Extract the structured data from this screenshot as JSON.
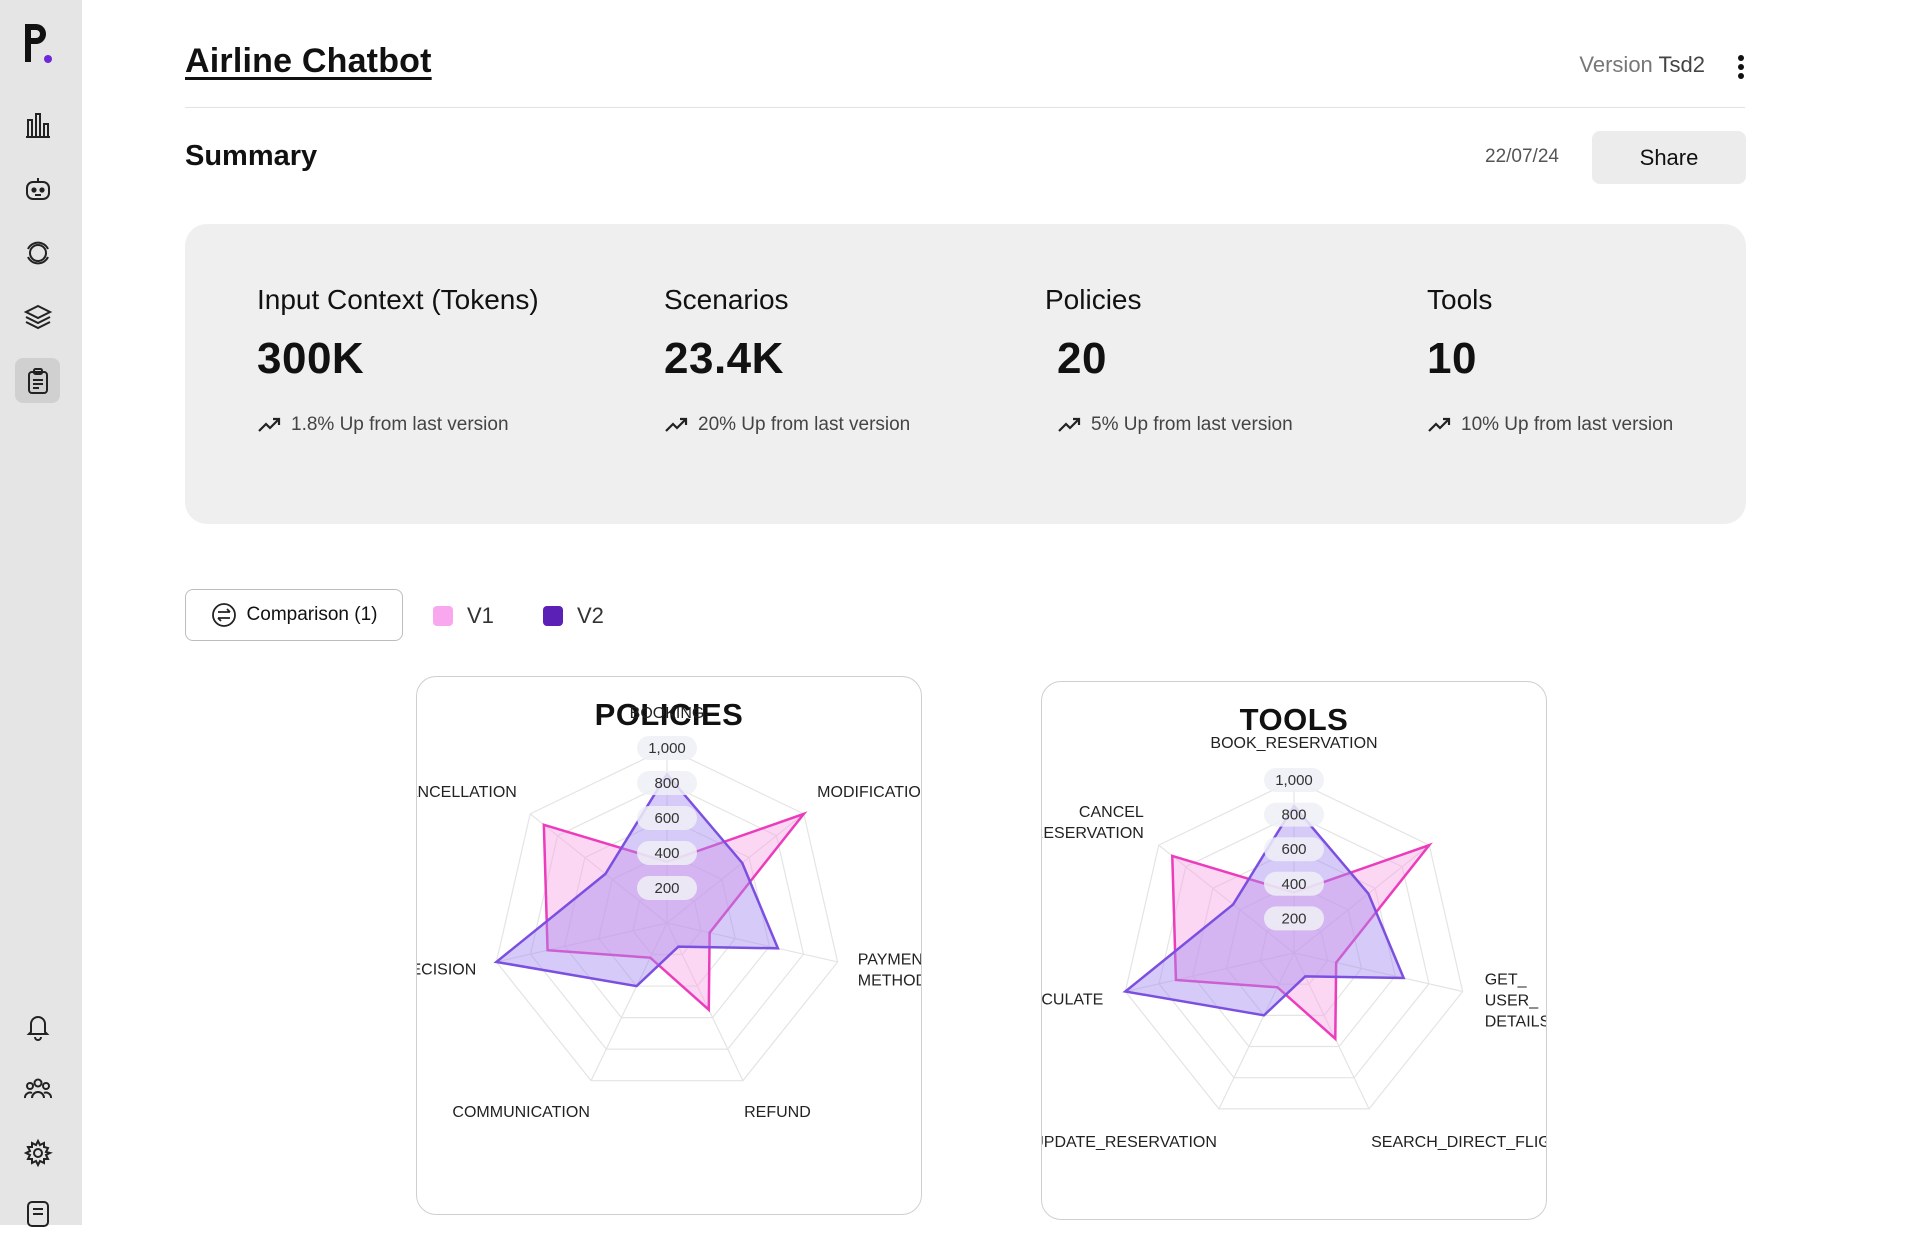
{
  "app": {
    "title": "Airline Chatbot",
    "version_label": "Version",
    "version_value": "Tsd2"
  },
  "sidebar": {
    "logo_letter": "P",
    "items": [
      {
        "icon": "bar-chart-icon"
      },
      {
        "icon": "bot-icon"
      },
      {
        "icon": "orbit-icon"
      },
      {
        "icon": "layers-icon"
      },
      {
        "icon": "clipboard-icon",
        "active": true
      },
      {
        "icon": "bell-icon"
      },
      {
        "icon": "team-icon"
      },
      {
        "icon": "gear-icon"
      },
      {
        "icon": "notes-icon"
      }
    ]
  },
  "summary": {
    "title": "Summary",
    "date": "22/07/24",
    "share_label": "Share"
  },
  "stats": [
    {
      "label": "Input Context (Tokens)",
      "value": "300K",
      "trend": "1.8% Up from last version"
    },
    {
      "label": "Scenarios",
      "value": "23.4K",
      "trend": "20% Up from last version"
    },
    {
      "label": "Policies",
      "value": "20",
      "trend": "5% Up from last version"
    },
    {
      "label": "Tools",
      "value": "10",
      "trend": "10% Up from last version"
    }
  ],
  "comparison": {
    "button_label": "Comparison (1)",
    "legend": [
      {
        "name": "V1",
        "color": "#f9a8f0"
      },
      {
        "name": "V2",
        "color": "#5b21b6"
      }
    ]
  },
  "colors": {
    "v1_stroke": "#ec3cbc",
    "v1_fill": "#f7a6e4",
    "v2_stroke": "#7b4fe0",
    "v2_fill": "#a38cf0"
  },
  "chart_data": [
    {
      "type": "radar",
      "title": "POLICIES",
      "axes": [
        "BOOKING",
        "MODIFICATION",
        "PAYMENT METHODS",
        "REFUND",
        "COMMUNICATION",
        "PRECISION",
        "CANCELLATION"
      ],
      "ticks": [
        "200",
        "400",
        "600",
        "800",
        "1,000"
      ],
      "range": [
        0,
        1000
      ],
      "series": [
        {
          "name": "V1",
          "values": [
            350,
            1000,
            250,
            550,
            220,
            700,
            900
          ]
        },
        {
          "name": "V2",
          "values": [
            850,
            550,
            650,
            150,
            400,
            1000,
            450
          ]
        }
      ]
    },
    {
      "type": "radar",
      "title": "TOOLS",
      "axes": [
        "BOOK_RESERVATION",
        "GET_\nUSER_\nDETAILS",
        "SEARCH_DIRECT_FLIGHT",
        "UPDATE_RESERVATION",
        "CALCULATE",
        "CANCEL\n_RESERVATION"
      ],
      "axis_labels_display": [
        "BOOK_RESERVATION",
        "GET_|USER_|DETAILS",
        "SEARCH_DIRECT_FLIGHT",
        "UPDATE_RESERVATION",
        "CALCULATE",
        "CANCEL|_RESERVATION"
      ],
      "ticks": [
        "200",
        "400",
        "600",
        "800",
        "1,000"
      ],
      "range": [
        0,
        1000
      ],
      "series": [
        {
          "name": "V1",
          "values": [
            350,
            1000,
            250,
            550,
            220,
            700,
            900
          ]
        },
        {
          "name": "V2",
          "values": [
            850,
            550,
            650,
            150,
            400,
            1000,
            450
          ]
        }
      ],
      "axis_count_note": "7"
    }
  ]
}
